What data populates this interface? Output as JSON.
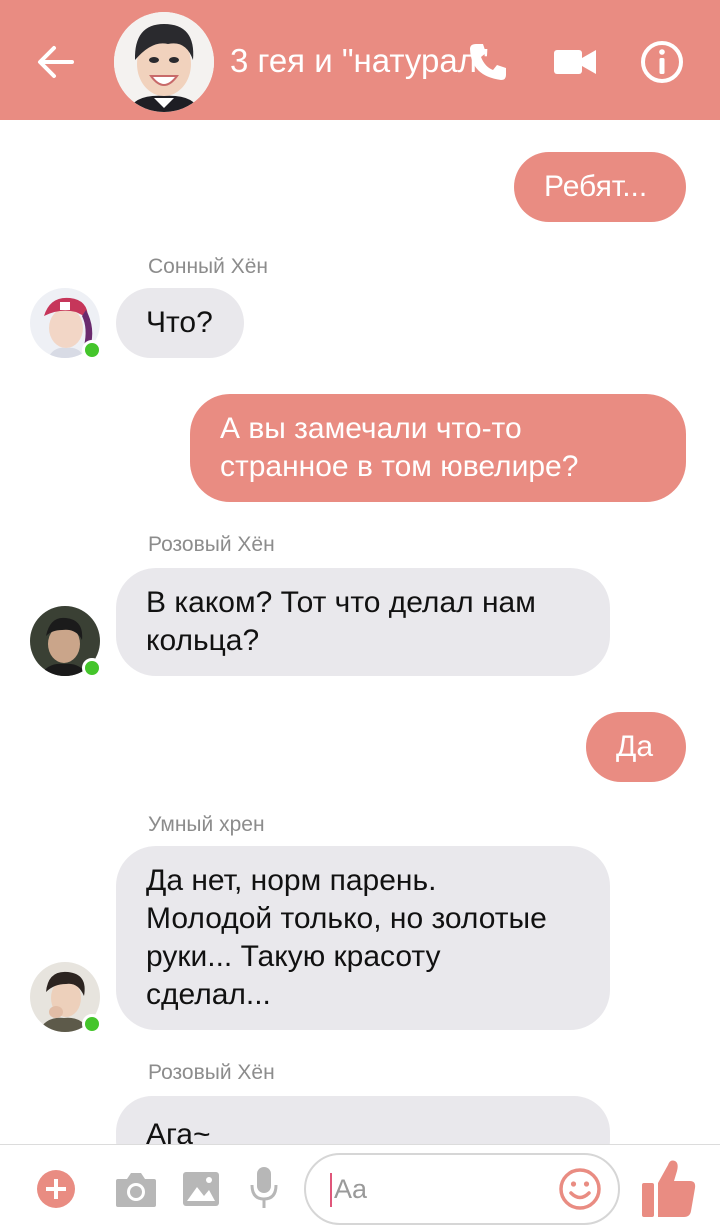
{
  "header": {
    "title": "3 гея и \"натурал\"",
    "back_icon": "arrow-left-icon",
    "call_icon": "phone-icon",
    "video_icon": "video-camera-icon",
    "info_icon": "info-icon"
  },
  "colors": {
    "accent": "#e98c82",
    "incoming_bubble": "#e9e8ec",
    "online_dot": "#44c52b",
    "sender_name": "#8c8c8c"
  },
  "messages": [
    {
      "direction": "out",
      "text": "Ребят..."
    },
    {
      "direction": "in",
      "sender": "Сонный Хён",
      "text": "Что?"
    },
    {
      "direction": "out",
      "lines": [
        "А вы замечали что-то",
        "странное в том ювелире?"
      ]
    },
    {
      "direction": "in",
      "sender": "Розовый Хён",
      "lines": [
        "В каком? Тот что делал нам",
        "кольца?"
      ]
    },
    {
      "direction": "out",
      "text": "Да"
    },
    {
      "direction": "in",
      "sender": "Умный хрен",
      "lines": [
        "Да нет, норм парень.",
        "Молодой только, но золотые",
        "руки... Такую красоту",
        "сделал..."
      ]
    },
    {
      "direction": "in",
      "sender": "Розовый Хён",
      "text": "Ага~"
    }
  ],
  "composer": {
    "placeholder": "Aa",
    "icons": [
      "plus-icon",
      "camera-icon",
      "image-icon",
      "microphone-icon",
      "emoji-icon",
      "thumbs-up-icon"
    ]
  }
}
